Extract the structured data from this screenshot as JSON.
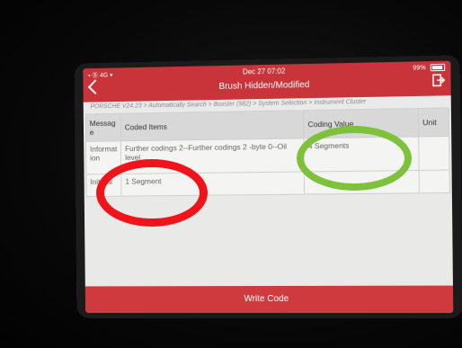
{
  "status": {
    "left": "▪ Ⓑ 4G ▾",
    "time": "Dec 27  07:02",
    "battery": "99%"
  },
  "header": {
    "title": "Brush Hidden/Modified"
  },
  "breadcrumb": "PORSCHE V24.23 > Automatically Search > Boxster (982) > System Selection > Instrument Cluster",
  "table": {
    "headers": [
      "Messag e",
      "Coded Items",
      "Coding Value",
      "Unit"
    ],
    "rows": [
      [
        "Informat ion",
        "Further codings 2--Further codings 2 -byte 0--Oil level",
        "4 Segments",
        ""
      ],
      [
        "Init Val",
        "1 Segment",
        "",
        ""
      ]
    ]
  },
  "buttons": {
    "write_code": "Write Code"
  },
  "colors": {
    "header": "#c8343a",
    "button": "#cf3a3f",
    "annotation_red": "#f0141a",
    "annotation_green": "#7ec23c"
  }
}
